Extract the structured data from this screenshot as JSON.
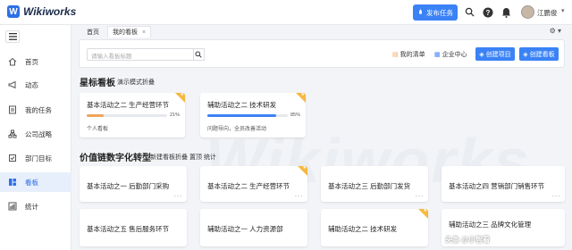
{
  "app": {
    "name": "Wikiworks",
    "logo_letter": "W"
  },
  "topbar": {
    "publish_label": "发布任务",
    "user_name": "江鹏俊",
    "icons": [
      "search-icon",
      "help-icon",
      "bell-icon",
      "avatar"
    ]
  },
  "sidebar": {
    "items": [
      {
        "label": "首页",
        "icon": "home-icon",
        "active": false
      },
      {
        "label": "动态",
        "icon": "megaphone-icon",
        "active": false
      },
      {
        "label": "我的任务",
        "icon": "task-icon",
        "active": false
      },
      {
        "label": "公司战略",
        "icon": "strategy-icon",
        "active": false
      },
      {
        "label": "部门目标",
        "icon": "target-icon",
        "active": false
      },
      {
        "label": "看板",
        "icon": "board-icon",
        "active": true
      },
      {
        "label": "统计",
        "icon": "stats-icon",
        "active": false
      }
    ]
  },
  "tabs": [
    {
      "label": "首页",
      "active": false
    },
    {
      "label": "我的看板",
      "active": true
    }
  ],
  "toolbar": {
    "search_placeholder": "请输入看板标题",
    "my_list": "我的清单",
    "enterprise": "企业中心",
    "create_project": "创建项目",
    "create_board": "创建看板"
  },
  "starred": {
    "title": "星标看板",
    "links": [
      "演示模式",
      "折叠"
    ],
    "cards": [
      {
        "title": "基本活动之二 生产经营环节",
        "progress": 0.21,
        "progress_label": "21%",
        "subtitle": "个人看板",
        "color": "#f0a35a",
        "starred": true
      },
      {
        "title": "辅助活动之二 技术研发",
        "progress": 0.85,
        "progress_label": "85%",
        "subtitle": "问题导向，全员改善活动",
        "color": "#3b82f6",
        "starred": true
      }
    ]
  },
  "chain": {
    "title": "价值链数字化转型",
    "links": [
      "新建看板",
      "折叠",
      "置顶",
      "统计"
    ],
    "cards": [
      {
        "title": "基本活动之一 后勤部门采购",
        "starred": false
      },
      {
        "title": "基本活动之二 生产经营环节",
        "starred": true
      },
      {
        "title": "基本活动之三 后勤部门发货",
        "starred": false
      },
      {
        "title": "基本活动之四 营销部门销售环节",
        "starred": false
      },
      {
        "title": "基本活动之五 售后服务环节",
        "starred": false
      },
      {
        "title": "辅助活动之一 人力资源部",
        "starred": false
      },
      {
        "title": "辅助活动之二 技术研发",
        "starred": true
      },
      {
        "title": "辅助活动之三 品牌文化管理",
        "starred": false
      }
    ]
  },
  "watermark": "Wikiworks",
  "credit": "头条 @小智看"
}
